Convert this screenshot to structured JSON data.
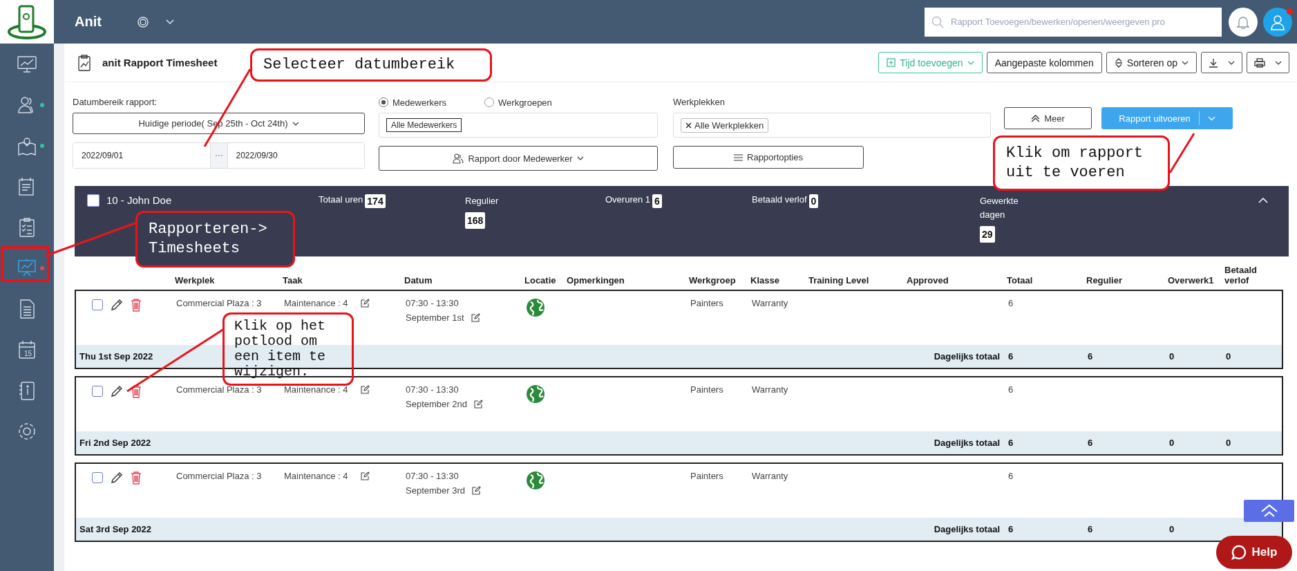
{
  "app": {
    "name": "Anit"
  },
  "topbar": {
    "search": {
      "placeholder": "Rapport Toevoegen/bewerken/openen/weergeven pro"
    },
    "profile_notification": true
  },
  "sidebar": {
    "items": [
      {
        "kind": "dashboard",
        "selected": false
      },
      {
        "kind": "users",
        "selected": false,
        "color": "#2ec4a0"
      },
      {
        "kind": "map",
        "selected": false,
        "color": "#2ec4a0"
      },
      {
        "kind": "calculator",
        "selected": false
      },
      {
        "kind": "checklist",
        "selected": false
      },
      {
        "kind": "report",
        "selected": true,
        "color": "#e2465a"
      },
      {
        "kind": "document",
        "selected": false
      },
      {
        "kind": "calendar",
        "selected": false,
        "icon_text": "15"
      },
      {
        "kind": "contacts",
        "selected": false
      },
      {
        "kind": "settings",
        "selected": false
      }
    ]
  },
  "page_header": {
    "title": "anit Rapport Timesheet",
    "buttons": [
      {
        "kind": "add",
        "label": "Tijd toevoegen"
      },
      {
        "kind": "plain",
        "label": "Aangepaste kolommen"
      },
      {
        "kind": "sort",
        "label": "Sorteren op"
      },
      {
        "kind": "download"
      },
      {
        "kind": "print"
      }
    ]
  },
  "filters": {
    "date_label": "Datumbereik rapport:",
    "period": "Huidige periode( Sep 25th - Oct 24th)",
    "start": "2022/09/01",
    "end": "2022/09/30",
    "radios": [
      {
        "label": "Medewerkers",
        "selected": true
      },
      {
        "label": "Werkgroepen",
        "selected": false
      }
    ],
    "employee_tag": "Alle Medewerkers",
    "report_by": "Rapport door Medewerker",
    "workplaces_label": "Werkplekken",
    "workplace_tag": "Alle Werkplekken",
    "options": "Rapportopties",
    "more": "Meer",
    "run": "Rapport uitvoeren"
  },
  "employee": {
    "checked": false,
    "name": "10 - John Doe",
    "expanded": true,
    "stats": [
      {
        "kind": "inline",
        "label": "Totaal uren",
        "value": "174"
      },
      {
        "kind": "stacked",
        "label": "Regulier",
        "value": "168"
      },
      {
        "kind": "inline",
        "label": "Overuren 1",
        "value": "6"
      },
      {
        "kind": "inline",
        "label": "Betaald verlof",
        "value": "0"
      },
      {
        "kind": "stacked",
        "label": "Gewerkte dagen",
        "value": "29"
      }
    ]
  },
  "table": {
    "columns": [
      "Werkplek",
      "Taak",
      "Datum",
      "Locatie",
      "Opmerkingen",
      "Werkgroep",
      "Klasse",
      "Training Level",
      "Approved",
      "Totaal",
      "Regulier",
      "Overwerk1",
      "Betaald verlof"
    ],
    "days": [
      {
        "checked": false,
        "workplace": "Commercial Plaza : 3",
        "task": "Maintenance : 4",
        "time": "07:30 - 13:30",
        "day": "September 1st",
        "workgroup": "Painters",
        "class": "Warranty",
        "total": "6",
        "date": "Thu 1st Sep 2022",
        "daily_label": "Dagelijks totaal",
        "daily": [
          "6",
          "6",
          "0",
          "0"
        ]
      },
      {
        "checked": false,
        "workplace": "Commercial Plaza : 3",
        "task": "Maintenance : 4",
        "time": "07:30 - 13:30",
        "day": "September 2nd",
        "workgroup": "Painters",
        "class": "Warranty",
        "total": "6",
        "date": "Fri 2nd Sep 2022",
        "daily_label": "Dagelijks totaal",
        "daily": [
          "6",
          "6",
          "0",
          "0"
        ]
      },
      {
        "checked": false,
        "workplace": "Commercial Plaza : 3",
        "task": "Maintenance : 4",
        "time": "07:30 - 13:30",
        "day": "September 3rd",
        "workgroup": "Painters",
        "class": "Warranty",
        "total": "6",
        "date": "Sat 3rd Sep 2022",
        "daily_label": "Dagelijks totaal",
        "daily": [
          "6",
          "6",
          "0"
        ]
      }
    ]
  },
  "help": {
    "label": "Help"
  },
  "callouts": [
    {
      "text": "Selecteer datumbereik"
    },
    {
      "text": "Klik om rapport uit te voeren"
    },
    {
      "text": "Rapporteren-> Timesheets"
    },
    {
      "text": "Klik op het potlood om een item te wijzigen."
    }
  ]
}
